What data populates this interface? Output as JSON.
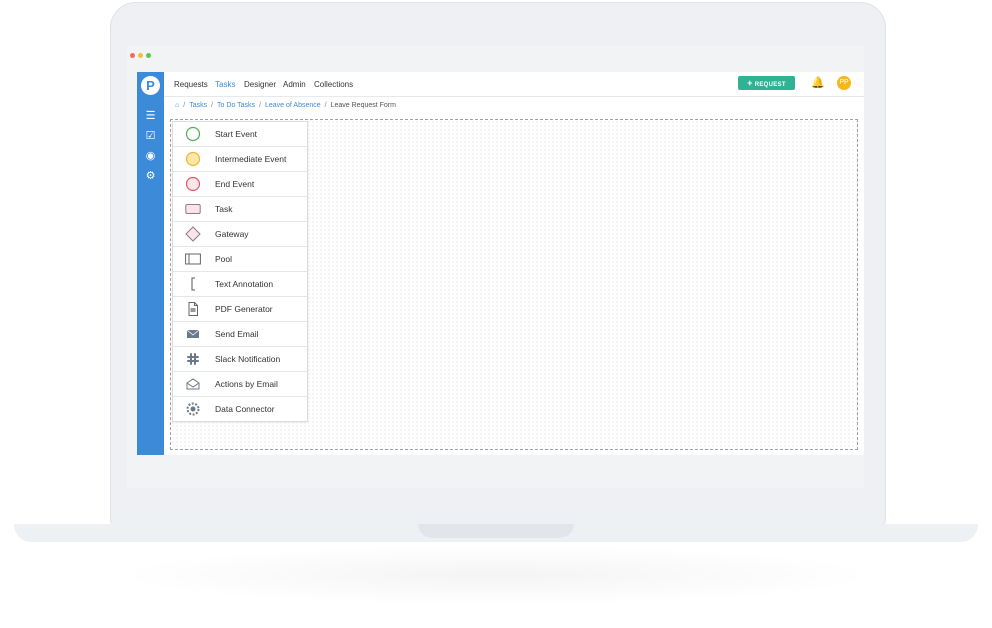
{
  "nav": {
    "items": [
      "Requests",
      "Tasks",
      "Designer",
      "Admin",
      "Collections"
    ],
    "request_button": "REQUEST",
    "avatar_initials": "PP"
  },
  "breadcrumb": [
    "Tasks",
    "To Do Tasks",
    "Leave of Absence",
    "Leave Request Form"
  ],
  "palette": {
    "items": [
      "Start Event",
      "Intermediate Event",
      "End Event",
      "Task",
      "Gateway",
      "Pool",
      "Text Annotation",
      "PDF Generator",
      "Send Email",
      "Slack Notification",
      "Actions by Email",
      "Data Connector"
    ]
  },
  "colors": {
    "sidebar": "#3b8bd8",
    "accent": "#2fb392",
    "start_event": "#4caf50",
    "intermediate_event": "#f6bd3b",
    "end_event": "#e05a6a"
  }
}
